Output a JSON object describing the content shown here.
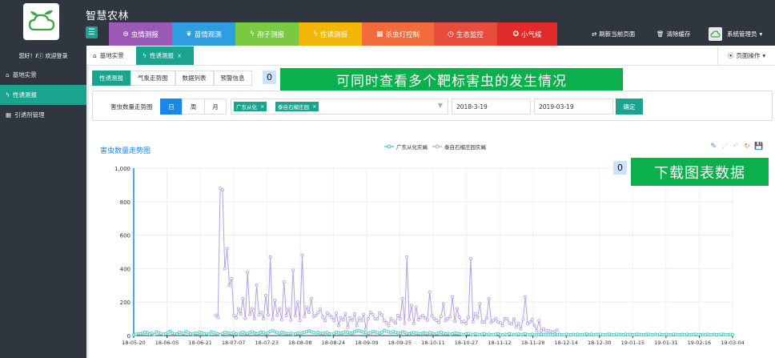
{
  "app": {
    "title": "智慧农林",
    "menu_toggle_icon": "list-icon",
    "nav": [
      {
        "label": "虫情测报",
        "icon": "bug-icon",
        "color": "#9b59b6"
      },
      {
        "label": "苗情观测",
        "icon": "leaf-icon",
        "color": "#2e9ee0"
      },
      {
        "label": "孢子测报",
        "icon": "pulse-icon",
        "color": "#7ac943"
      },
      {
        "label": "性诱测报",
        "icon": "pulse-icon",
        "color": "#f2b705"
      },
      {
        "label": "杀虫灯控制",
        "icon": "grid-icon",
        "color": "#f26b3a"
      },
      {
        "label": "生态监控",
        "icon": "clock-icon",
        "color": "#e84c3d"
      },
      {
        "label": "小气候",
        "icon": "compass-icon",
        "color": "#e12b2b"
      }
    ],
    "refresh_label": "刷新当前页面",
    "clear_cache_label": "清除缓存",
    "user_label": "系统管理员"
  },
  "sidebar": {
    "welcome": "您好！ℓⓡ 欢迎登录",
    "items": [
      {
        "label": "基地实景",
        "icon": "home-icon",
        "active": false
      },
      {
        "label": "性诱测报",
        "icon": "pulse-icon",
        "active": true
      },
      {
        "label": "引诱剂管理",
        "icon": "grid-icon",
        "active": false
      }
    ]
  },
  "page_tabs": [
    {
      "label": "基地实景",
      "icon": "home-icon",
      "active": false
    },
    {
      "label": "性诱测报",
      "icon": "pulse-icon",
      "active": true,
      "close": "×"
    }
  ],
  "page_ops_label": "页面操作",
  "subtabs": [
    "性诱测报",
    "气象走势图",
    "数据列表",
    "预警信息"
  ],
  "annotations": [
    {
      "count": "0",
      "text": "可同时查看多个靶标害虫的发生情况"
    },
    {
      "count": "0",
      "text": "下载图表数据"
    }
  ],
  "filter": {
    "label": "害虫数量走势图",
    "granularity": [
      "日",
      "周",
      "月"
    ],
    "selected": [
      "广东从化",
      "泰自石榴庄园"
    ],
    "start_date": "2018-3-19",
    "end_date": "2019-03-19",
    "confirm_label": "确定"
  },
  "chart_data": {
    "type": "line",
    "title": "害虫数量走势图",
    "ylim": [
      0,
      1000
    ],
    "yticks": [
      "0",
      "200",
      "400",
      "600",
      "800",
      "1,000"
    ],
    "xticks": [
      "18-05-20",
      "18-06-05",
      "18-06-21",
      "18-07-07",
      "18-07-23",
      "18-08-08",
      "18-08-24",
      "18-09-09",
      "18-09-25",
      "18-10-11",
      "18-10-27",
      "18-11-12",
      "18-11-28",
      "18-12-14",
      "18-12-30",
      "19-01-15",
      "19-01-31",
      "19-02-16",
      "19-03-04"
    ],
    "grid": true,
    "legend_position": "top",
    "series": [
      {
        "name": "广东从化实蝇",
        "color": "#3cc7c0",
        "values": [
          5,
          8,
          12,
          10,
          15,
          20,
          18,
          9,
          14,
          6,
          22,
          16,
          12,
          8,
          10,
          18,
          25,
          14,
          11,
          9,
          20,
          16,
          12,
          24,
          18,
          10,
          8,
          14,
          12,
          20,
          16,
          9,
          12,
          8,
          22,
          18,
          14,
          10,
          6,
          12,
          20,
          16,
          14,
          12,
          18,
          10,
          8,
          16,
          20,
          14,
          12,
          18,
          22,
          16,
          10,
          14,
          20,
          18,
          12,
          16,
          24,
          30,
          22,
          18,
          14,
          20,
          16,
          12,
          10,
          14,
          8,
          10,
          14,
          12,
          16,
          20,
          24,
          28,
          22,
          18,
          16,
          20,
          14,
          12,
          16,
          18,
          10,
          8,
          12,
          20,
          16,
          14,
          18,
          22,
          20,
          16,
          14,
          22,
          30,
          28,
          24,
          20,
          18,
          14,
          16,
          24,
          22,
          18,
          14,
          20,
          30,
          26,
          22,
          18,
          24,
          20,
          16,
          14,
          22,
          20,
          12,
          10,
          16,
          18,
          14,
          12,
          10,
          16,
          14,
          12,
          18,
          14,
          10,
          12,
          16,
          20,
          14,
          10,
          12,
          8,
          10,
          14,
          12,
          10,
          8,
          6,
          10,
          12,
          8,
          6,
          10,
          8,
          6,
          8,
          10,
          6,
          8,
          4,
          6,
          8,
          10,
          6,
          5,
          8,
          6,
          10,
          8,
          6,
          7,
          9,
          6,
          8,
          10,
          6,
          5,
          8,
          6,
          4,
          7,
          8,
          6,
          5,
          7,
          6,
          5,
          8,
          6,
          7,
          5,
          6,
          8,
          6,
          5,
          7,
          6,
          8,
          5,
          6,
          7,
          9,
          6,
          8,
          5,
          6,
          7,
          8,
          6,
          5,
          7,
          8,
          6,
          5,
          8,
          7,
          6,
          5,
          8,
          6,
          7,
          5,
          6,
          8,
          7,
          6,
          5,
          7,
          8,
          6,
          5,
          7,
          6,
          8,
          5,
          6,
          7,
          6,
          5,
          8,
          7,
          6,
          5,
          7,
          6,
          8,
          5,
          6,
          7,
          8,
          6,
          5,
          7,
          6,
          8,
          5,
          6,
          7,
          5,
          6,
          8,
          7,
          6,
          5,
          7,
          6
        ]
      },
      {
        "name": "泰自石榴庄园实蝇",
        "color": "#b59fe0",
        "values": [
          null,
          null,
          null,
          null,
          null,
          null,
          null,
          null,
          null,
          null,
          null,
          null,
          null,
          null,
          null,
          null,
          null,
          null,
          null,
          null,
          null,
          null,
          null,
          null,
          null,
          null,
          null,
          null,
          null,
          null,
          null,
          null,
          null,
          null,
          null,
          null,
          null,
          null,
          null,
          null,
          null,
          null,
          null,
          null,
          null,
          null,
          null,
          null,
          null,
          null,
          null,
          null,
          null,
          null,
          null,
          null,
          null,
          null,
          null,
          null,
          null,
          null,
          null,
          null,
          null,
          null,
          null,
          null,
          null,
          null,
          null,
          null,
          null,
          null,
          null,
          null,
          null,
          null,
          null,
          null,
          null,
          null,
          null,
          null,
          null,
          null,
          null,
          null,
          null,
          null,
          null,
          null,
          null,
          null,
          null,
          null,
          null,
          null,
          null,
          null,
          null,
          null,
          null,
          null,
          null,
          null,
          null,
          null,
          null,
          null,
          null,
          null,
          null,
          null,
          null,
          null,
          null,
          null,
          null,
          null,
          null,
          null,
          null,
          null,
          null,
          null,
          null,
          null,
          null,
          null,
          null,
          null,
          null,
          null,
          null,
          null,
          null,
          null,
          null,
          null,
          null,
          null,
          null,
          null,
          null,
          null,
          null,
          null,
          null,
          null,
          null,
          null,
          null,
          null,
          null,
          null,
          null,
          null,
          null,
          null,
          null,
          null,
          null,
          null,
          null,
          null,
          null,
          null,
          null,
          null,
          null,
          null,
          null,
          null,
          null,
          null,
          null,
          null,
          null,
          null,
          null,
          null,
          null,
          null,
          null,
          null,
          null,
          null,
          null,
          null,
          null,
          null,
          null,
          null,
          null,
          null,
          null,
          null,
          null,
          null,
          null,
          null,
          null,
          null,
          null,
          null,
          null,
          null,
          null,
          null,
          null,
          null,
          null,
          null,
          null,
          null,
          null,
          null,
          null,
          null,
          null,
          null,
          null,
          null,
          null,
          null,
          null,
          null,
          null,
          null,
          null,
          null,
          null,
          null,
          null,
          null,
          null,
          null,
          null,
          null,
          null,
          null,
          null,
          null,
          null,
          null,
          null,
          null,
          null,
          null,
          null,
          null,
          null,
          null,
          null,
          null,
          null,
          null,
          null,
          null
        ]
      }
    ]
  }
}
